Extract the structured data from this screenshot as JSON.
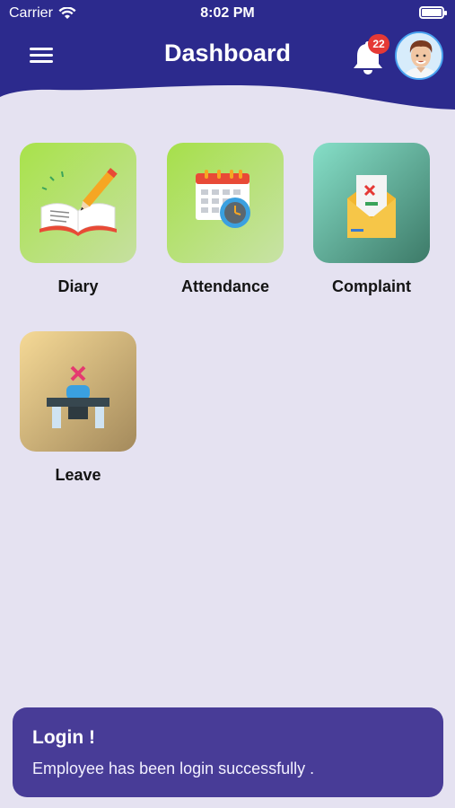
{
  "status_bar": {
    "carrier": "Carrier",
    "time": "8:02 PM"
  },
  "header": {
    "title": "Dashboard",
    "notification_count": "22",
    "colors": {
      "header_bg": "#2c2a8d",
      "badge": "#e53935"
    }
  },
  "tiles": [
    {
      "label": "Diary",
      "icon": "diary-book-pencil-icon"
    },
    {
      "label": "Attendance",
      "icon": "calendar-clock-icon"
    },
    {
      "label": "Complaint",
      "icon": "envelope-letter-icon"
    },
    {
      "label": "Leave",
      "icon": "desk-cross-icon"
    }
  ],
  "toast": {
    "title": "Login !",
    "message": "Employee has been login successfully ."
  }
}
